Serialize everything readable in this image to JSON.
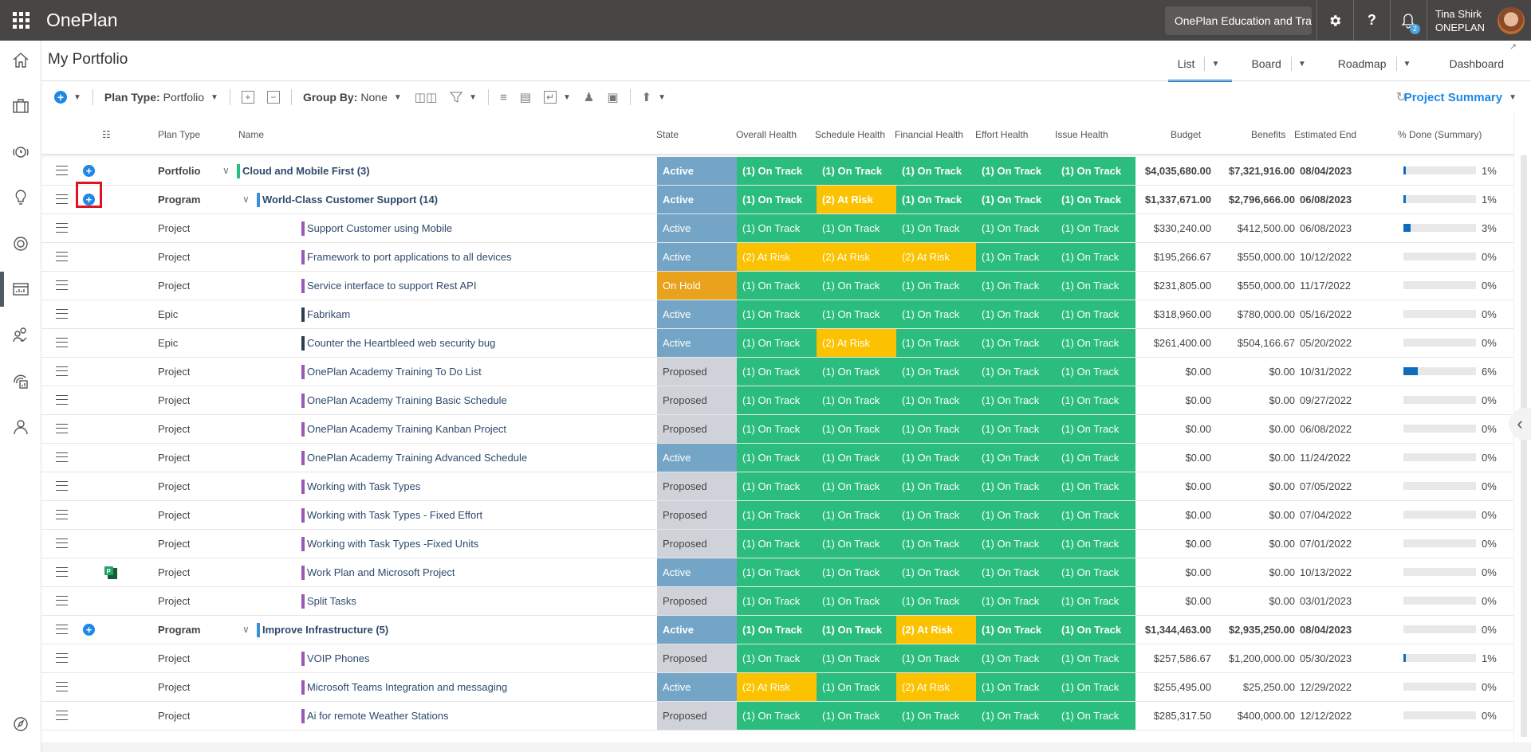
{
  "app": {
    "name": "OnePlan",
    "site_name": "OnePlan Education and Training",
    "notification_count": "2",
    "user_name": "Tina Shirk",
    "user_org": "ONEPLAN",
    "help_label": "?"
  },
  "sidebar": {
    "items": [
      {
        "name": "home",
        "active": false
      },
      {
        "name": "portfolio",
        "active": false
      },
      {
        "name": "time",
        "active": false
      },
      {
        "name": "ideas",
        "active": false
      },
      {
        "name": "goals",
        "active": false
      },
      {
        "name": "reports",
        "active": true
      },
      {
        "name": "resources",
        "active": false
      },
      {
        "name": "analytics",
        "active": false
      },
      {
        "name": "profile",
        "active": false
      },
      {
        "name": "explore",
        "active": false
      }
    ]
  },
  "page": {
    "title": "My Portfolio"
  },
  "views": [
    {
      "label": "List",
      "active": true,
      "has_dropdown": true
    },
    {
      "label": "Board",
      "active": false,
      "has_dropdown": true
    },
    {
      "label": "Roadmap",
      "active": false,
      "has_dropdown": true
    },
    {
      "label": "Dashboard",
      "active": false,
      "has_dropdown": false
    }
  ],
  "toolbar": {
    "plan_type_label": "Plan Type:",
    "plan_type_value": "Portfolio",
    "group_by_label": "Group By:",
    "group_by_value": "None",
    "summary_label": "Project Summary"
  },
  "columns": {
    "plan_type": "Plan Type",
    "name": "Name",
    "state": "State",
    "overall": "Overall Health",
    "schedule": "Schedule Health",
    "financial": "Financial Health",
    "effort": "Effort Health",
    "issue": "Issue Health",
    "budget": "Budget",
    "benefits": "Benefits",
    "end": "Estimated End",
    "done": "% Done (Summary)"
  },
  "colors": {
    "on_track": "#2bbd7e",
    "at_risk": "#fcc200",
    "active": "#74a5c6",
    "on_hold": "#e8a21c",
    "proposed": "#cfd2d9",
    "portfolio_bar": "#2bbd7e",
    "program_bar": "#3d8fd6",
    "project_bar": "#9b59b6",
    "epic_bar": "#2c3e50",
    "accent": "#1e88e5"
  },
  "rows": [
    {
      "plan_type": "Portfolio",
      "level": 0,
      "bold": true,
      "add": true,
      "expand": true,
      "name": "Cloud and Mobile First (3)",
      "state": "Active",
      "health": [
        "(1) On Track",
        "(1) On Track",
        "(1) On Track",
        "(1) On Track",
        "(1) On Track"
      ],
      "budget": "$4,035,680.00",
      "benefits": "$7,321,916.00",
      "end": "08/04/2023",
      "done": 1,
      "done_label": "1%"
    },
    {
      "plan_type": "Program",
      "level": 1,
      "bold": true,
      "add": true,
      "highlight": true,
      "expand": true,
      "name": "World-Class Customer Support (14)",
      "state": "Active",
      "health": [
        "(1) On Track",
        "(2) At Risk",
        "(1) On Track",
        "(1) On Track",
        "(1) On Track"
      ],
      "budget": "$1,337,671.00",
      "benefits": "$2,796,666.00",
      "end": "06/08/2023",
      "done": 1,
      "done_label": "1%"
    },
    {
      "plan_type": "Project",
      "level": 2,
      "name": "Support Customer using Mobile",
      "state": "Active",
      "health": [
        "(1) On Track",
        "(1) On Track",
        "(1) On Track",
        "(1) On Track",
        "(1) On Track"
      ],
      "budget": "$330,240.00",
      "benefits": "$412,500.00",
      "end": "06/08/2023",
      "done": 3,
      "done_label": "3%"
    },
    {
      "plan_type": "Project",
      "level": 2,
      "name": "Framework to port applications to all devices",
      "state": "Active",
      "health": [
        "(2) At Risk",
        "(2) At Risk",
        "(2) At Risk",
        "(1) On Track",
        "(1) On Track"
      ],
      "budget": "$195,266.67",
      "benefits": "$550,000.00",
      "end": "10/12/2022",
      "done": 0,
      "done_label": "0%"
    },
    {
      "plan_type": "Project",
      "level": 2,
      "name": "Service interface to support Rest API",
      "state": "On Hold",
      "health": [
        "(1) On Track",
        "(1) On Track",
        "(1) On Track",
        "(1) On Track",
        "(1) On Track"
      ],
      "budget": "$231,805.00",
      "benefits": "$550,000.00",
      "end": "11/17/2022",
      "done": 0,
      "done_label": "0%"
    },
    {
      "plan_type": "Epic",
      "level": 2,
      "name": "Fabrikam",
      "state": "Active",
      "health": [
        "(1) On Track",
        "(1) On Track",
        "(1) On Track",
        "(1) On Track",
        "(1) On Track"
      ],
      "budget": "$318,960.00",
      "benefits": "$780,000.00",
      "end": "05/16/2022",
      "done": 0,
      "done_label": "0%"
    },
    {
      "plan_type": "Epic",
      "level": 2,
      "name": "Counter the Heartbleed web security bug",
      "state": "Active",
      "health": [
        "(1) On Track",
        "(2) At Risk",
        "(1) On Track",
        "(1) On Track",
        "(1) On Track"
      ],
      "budget": "$261,400.00",
      "benefits": "$504,166.67",
      "end": "05/20/2022",
      "done": 0,
      "done_label": "0%"
    },
    {
      "plan_type": "Project",
      "level": 2,
      "name": "OnePlan Academy Training To Do List",
      "state": "Proposed",
      "health": [
        "(1) On Track",
        "(1) On Track",
        "(1) On Track",
        "(1) On Track",
        "(1) On Track"
      ],
      "budget": "$0.00",
      "benefits": "$0.00",
      "end": "10/31/2022",
      "done": 6,
      "done_label": "6%"
    },
    {
      "plan_type": "Project",
      "level": 2,
      "name": "OnePlan Academy Training Basic Schedule",
      "state": "Proposed",
      "health": [
        "(1) On Track",
        "(1) On Track",
        "(1) On Track",
        "(1) On Track",
        "(1) On Track"
      ],
      "budget": "$0.00",
      "benefits": "$0.00",
      "end": "09/27/2022",
      "done": 0,
      "done_label": "0%"
    },
    {
      "plan_type": "Project",
      "level": 2,
      "name": "OnePlan Academy Training Kanban Project",
      "state": "Proposed",
      "health": [
        "(1) On Track",
        "(1) On Track",
        "(1) On Track",
        "(1) On Track",
        "(1) On Track"
      ],
      "budget": "$0.00",
      "benefits": "$0.00",
      "end": "06/08/2022",
      "done": 0,
      "done_label": "0%"
    },
    {
      "plan_type": "Project",
      "level": 2,
      "name": "OnePlan Academy Training Advanced Schedule",
      "state": "Active",
      "health": [
        "(1) On Track",
        "(1) On Track",
        "(1) On Track",
        "(1) On Track",
        "(1) On Track"
      ],
      "budget": "$0.00",
      "benefits": "$0.00",
      "end": "11/24/2022",
      "done": 0,
      "done_label": "0%"
    },
    {
      "plan_type": "Project",
      "level": 2,
      "name": "Working with Task Types",
      "state": "Proposed",
      "health": [
        "(1) On Track",
        "(1) On Track",
        "(1) On Track",
        "(1) On Track",
        "(1) On Track"
      ],
      "budget": "$0.00",
      "benefits": "$0.00",
      "end": "07/05/2022",
      "done": 0,
      "done_label": "0%"
    },
    {
      "plan_type": "Project",
      "level": 2,
      "name": "Working with Task Types - Fixed Effort",
      "state": "Proposed",
      "health": [
        "(1) On Track",
        "(1) On Track",
        "(1) On Track",
        "(1) On Track",
        "(1) On Track"
      ],
      "budget": "$0.00",
      "benefits": "$0.00",
      "end": "07/04/2022",
      "done": 0,
      "done_label": "0%"
    },
    {
      "plan_type": "Project",
      "level": 2,
      "name": "Working with Task Types -Fixed Units",
      "state": "Proposed",
      "health": [
        "(1) On Track",
        "(1) On Track",
        "(1) On Track",
        "(1) On Track",
        "(1) On Track"
      ],
      "budget": "$0.00",
      "benefits": "$0.00",
      "end": "07/01/2022",
      "done": 0,
      "done_label": "0%"
    },
    {
      "plan_type": "Project",
      "level": 2,
      "msproject": true,
      "name": "Work Plan and Microsoft Project",
      "state": "Active",
      "health": [
        "(1) On Track",
        "(1) On Track",
        "(1) On Track",
        "(1) On Track",
        "(1) On Track"
      ],
      "budget": "$0.00",
      "benefits": "$0.00",
      "end": "10/13/2022",
      "done": 0,
      "done_label": "0%"
    },
    {
      "plan_type": "Project",
      "level": 2,
      "name": "Split Tasks",
      "state": "Proposed",
      "health": [
        "(1) On Track",
        "(1) On Track",
        "(1) On Track",
        "(1) On Track",
        "(1) On Track"
      ],
      "budget": "$0.00",
      "benefits": "$0.00",
      "end": "03/01/2023",
      "done": 0,
      "done_label": "0%"
    },
    {
      "plan_type": "Program",
      "level": 1,
      "bold": true,
      "add": true,
      "expand": true,
      "name": "Improve Infrastructure (5)",
      "state": "Active",
      "health": [
        "(1) On Track",
        "(1) On Track",
        "(2) At Risk",
        "(1) On Track",
        "(1) On Track"
      ],
      "budget": "$1,344,463.00",
      "benefits": "$2,935,250.00",
      "end": "08/04/2023",
      "done": 0,
      "done_label": "0%"
    },
    {
      "plan_type": "Project",
      "level": 2,
      "name": "VOIP Phones",
      "state": "Proposed",
      "health": [
        "(1) On Track",
        "(1) On Track",
        "(1) On Track",
        "(1) On Track",
        "(1) On Track"
      ],
      "budget": "$257,586.67",
      "benefits": "$1,200,000.00",
      "end": "05/30/2023",
      "done": 1,
      "done_label": "1%"
    },
    {
      "plan_type": "Project",
      "level": 2,
      "name": "Microsoft Teams Integration and messaging",
      "state": "Active",
      "health": [
        "(2) At Risk",
        "(1) On Track",
        "(2) At Risk",
        "(1) On Track",
        "(1) On Track"
      ],
      "budget": "$255,495.00",
      "benefits": "$25,250.00",
      "end": "12/29/2022",
      "done": 0,
      "done_label": "0%"
    },
    {
      "plan_type": "Project",
      "level": 2,
      "name": "Ai for remote Weather Stations",
      "state": "Proposed",
      "health": [
        "(1) On Track",
        "(1) On Track",
        "(1) On Track",
        "(1) On Track",
        "(1) On Track"
      ],
      "budget": "$285,317.50",
      "benefits": "$400,000.00",
      "end": "12/12/2022",
      "done": 0,
      "done_label": "0%"
    }
  ]
}
